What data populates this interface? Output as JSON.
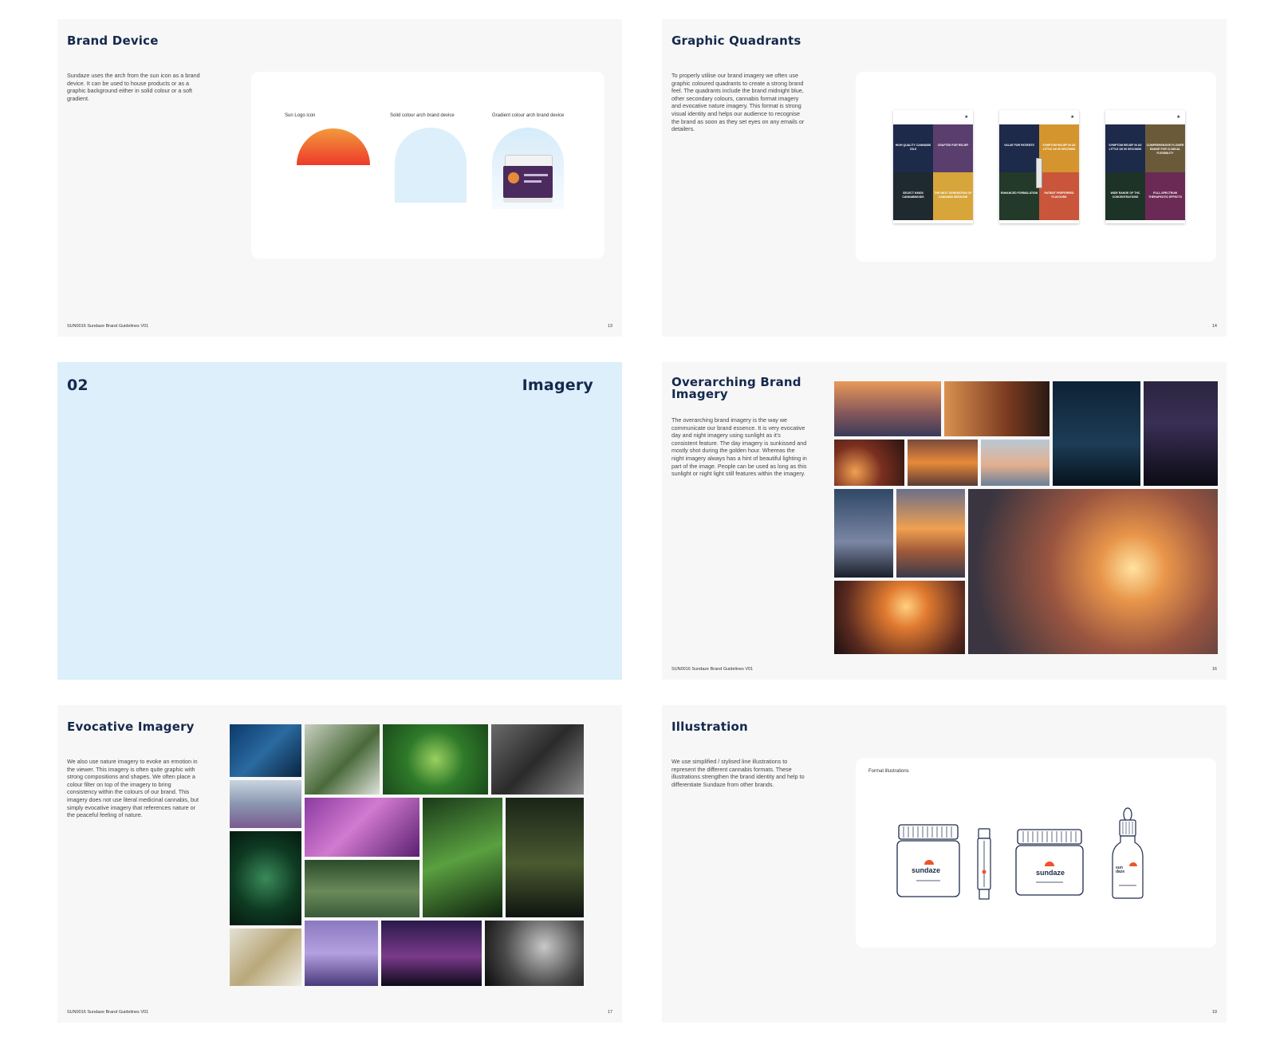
{
  "footer_text": "SUN0016 Sundaze Brand Guidelines V01",
  "pages": {
    "brand_device": {
      "title": "Brand Device",
      "body": "Sundaze uses the arch from the sun icon as a brand device. It can be used to house products or as a graphic background either in solid colour or a soft gradient.",
      "captions": [
        "Sun Logo icon",
        "Solid colour arch brand device",
        "Gradient colour arch brand device"
      ],
      "page_number": "13"
    },
    "graphic_quadrants": {
      "title": "Graphic Quadrants",
      "body": "To properly utilise our brand imagery we often use graphic coloured quadrants to create a strong brand feel. The quadrants include the brand midnight blue, other secondary colours, cannabis format imagery and evocative nature imagery. This format is strong visual identity and helps our audience to recognise the brand as soon as they set eyes on any emails or detailers.",
      "page_number": "14",
      "detailers": [
        {
          "quads": [
            "HIGH QUALITY CANNABIS OILS",
            "CRAFTED FOR RELIEF",
            "SELECT KINDS CANNABINOIDS",
            "THE NEXT GENERATION OF CANNABIS MEDICINE"
          ]
        },
        {
          "quads": [
            "VALUE FOR PATIENTS",
            "SYMPTOM RELIEF IN AS LITTLE AS 90 SECONDS",
            "ENHANCED FORMULATION",
            "PATIENT PREFERRED FLAVOURS"
          ]
        },
        {
          "quads": [
            "SYMPTOM RELIEF IN AS LITTLE AS 90 SECONDS",
            "COMPREHENSIVE FLOWER RANGE FOR CLINICAL FLEXIBILITY",
            "WIDE RANGE OF THC CONCENTRATIONS",
            "FULL-SPECTRUM THERAPEUTIC EFFECTS"
          ]
        }
      ]
    },
    "divider": {
      "number": "02",
      "title": "Imagery"
    },
    "overarching": {
      "title": "Overarching Brand Imagery",
      "body": "The overarching brand imagery is the way we communicate our brand essence. It is very evocative day and night imagery using sunlight as it's consistent feature. The day imagery is sunkissed and mostly shot during the golden hour. Whereas the night imagery always has a hint of beautiful lighting in part of the image. People can be used as long as this sunlight or night light still features within the imagery.",
      "page_number": "16"
    },
    "evocative": {
      "title": "Evocative Imagery",
      "body": "We also use nature imagery to evoke an emotion in the viewer. This imagery is often quite graphic with strong compositions and shapes. We often place a colour filter on top of the imagery to bring consistency within the colours of our brand. This imagery does not use literal medicinal cannabis, but simply evocative imagery that references nature or the peaceful feeling of nature.",
      "page_number": "17"
    },
    "illustration": {
      "title": "Illustration",
      "body": "We use simplified / stylised line illustrations to represent the different cannabis formats. These illustrations strengthen the brand identity and help to differentiate Sundaze from other brands.",
      "caption": "Format illustrations",
      "page_number": "19",
      "jar_logo": "sundaze",
      "bottle_logo": "sun daze"
    }
  },
  "colors": {
    "midnight_blue": "#1d2a4a",
    "sun_orange": "#f0532b",
    "sun_yellow": "#f29a3c",
    "sky_light": "#dceffa",
    "page_bg": "#f7f7f7"
  }
}
